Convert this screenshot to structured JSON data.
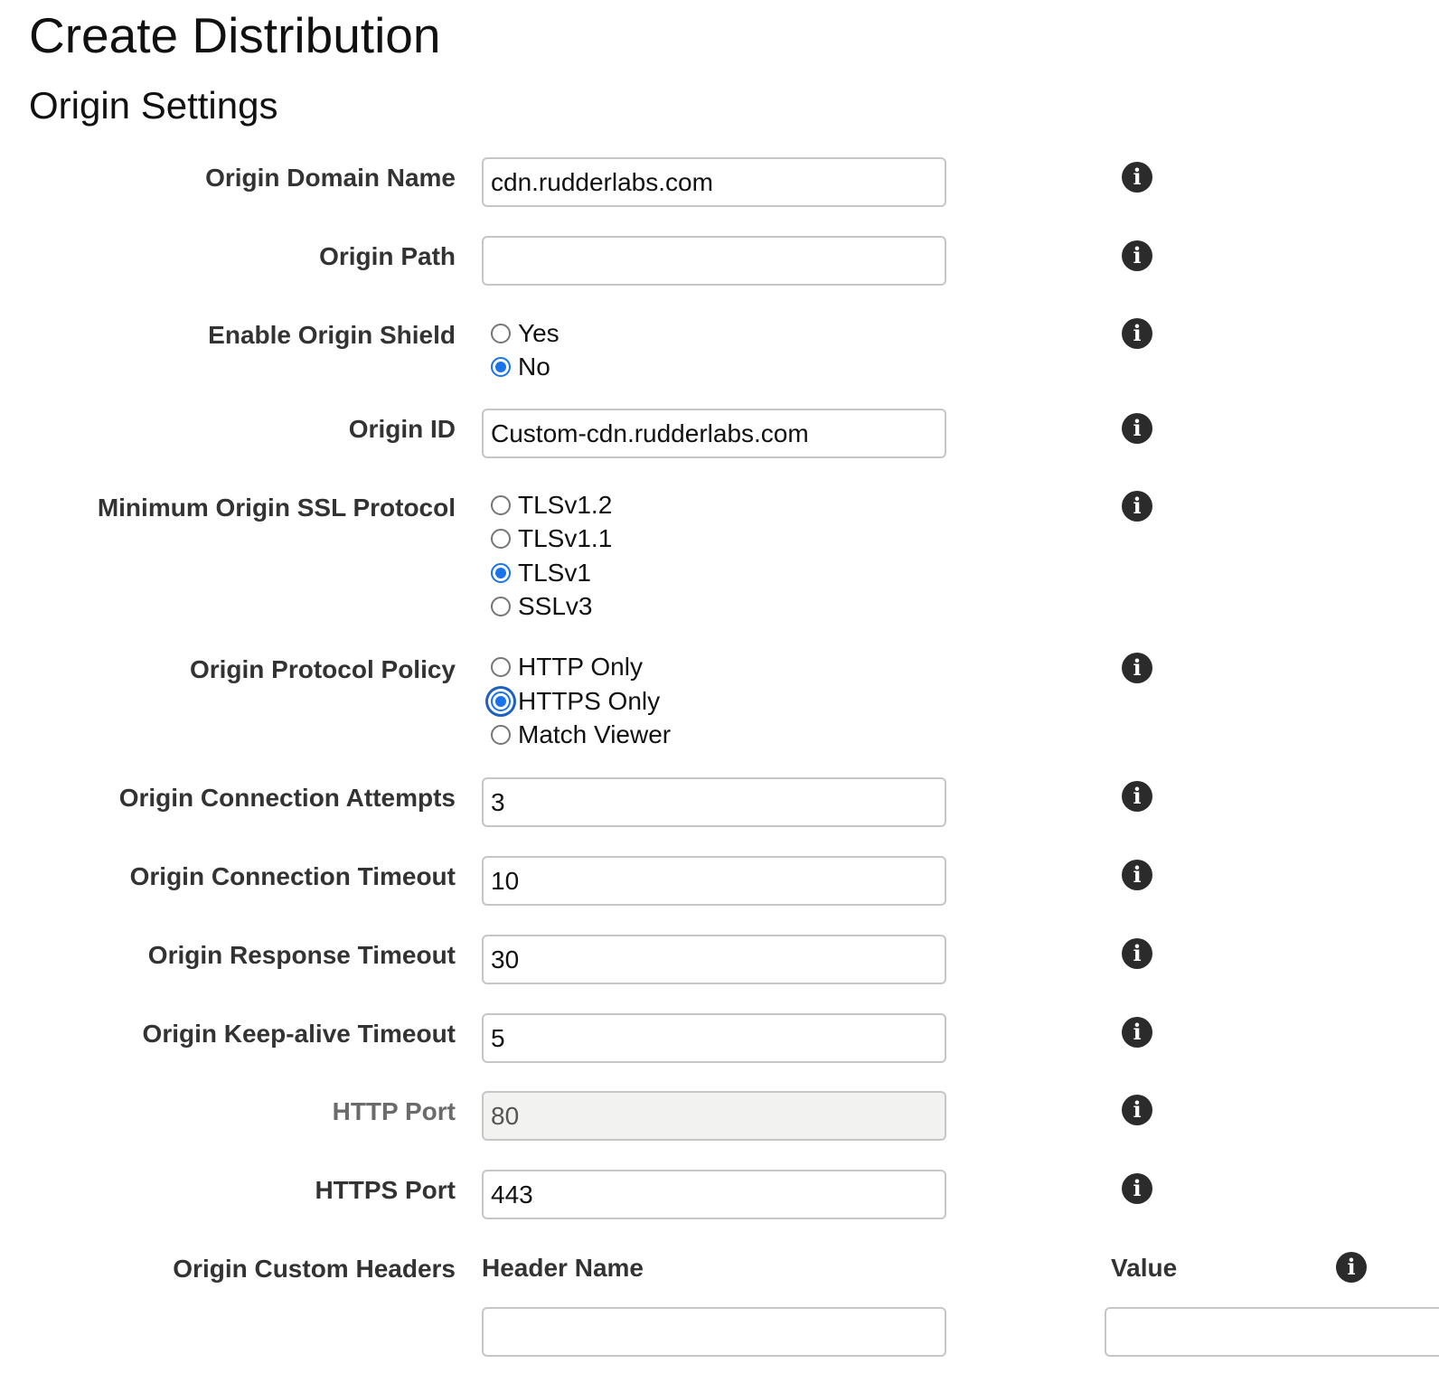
{
  "page": {
    "title": "Create Distribution",
    "section_title": "Origin Settings"
  },
  "icons": {
    "info": "info-circle-icon"
  },
  "colors": {
    "radio_selected": "#1a73e8",
    "focus_ring": "#1f5fbf",
    "disabled_field_bg": "#f2f2f0",
    "label_text": "#333333"
  },
  "form": {
    "origin_domain_name": {
      "label": "Origin Domain Name",
      "value": "cdn.rudderlabs.com"
    },
    "origin_path": {
      "label": "Origin Path",
      "value": ""
    },
    "enable_origin_shield": {
      "label": "Enable Origin Shield",
      "options": [
        "Yes",
        "No"
      ],
      "selected": "No"
    },
    "origin_id": {
      "label": "Origin ID",
      "value": "Custom-cdn.rudderlabs.com"
    },
    "min_ssl_protocol": {
      "label": "Minimum Origin SSL Protocol",
      "options": [
        "TLSv1.2",
        "TLSv1.1",
        "TLSv1",
        "SSLv3"
      ],
      "selected": "TLSv1"
    },
    "origin_protocol_policy": {
      "label": "Origin Protocol Policy",
      "options": [
        "HTTP Only",
        "HTTPS Only",
        "Match Viewer"
      ],
      "selected": "HTTPS Only",
      "focused": "HTTPS Only"
    },
    "connection_attempts": {
      "label": "Origin Connection Attempts",
      "value": "3"
    },
    "connection_timeout": {
      "label": "Origin Connection Timeout",
      "value": "10"
    },
    "response_timeout": {
      "label": "Origin Response Timeout",
      "value": "30"
    },
    "keepalive_timeout": {
      "label": "Origin Keep-alive Timeout",
      "value": "5"
    },
    "http_port": {
      "label": "HTTP Port",
      "value": "80",
      "disabled": true
    },
    "https_port": {
      "label": "HTTPS Port",
      "value": "443"
    },
    "custom_headers": {
      "label": "Origin Custom Headers",
      "header_name_label": "Header Name",
      "value_label": "Value",
      "header_name": "",
      "value": ""
    }
  }
}
